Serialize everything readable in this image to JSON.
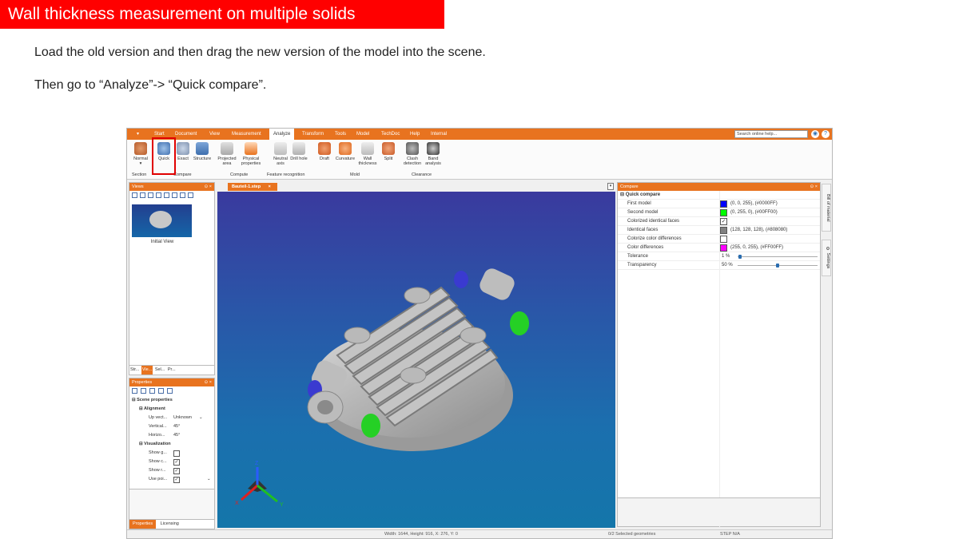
{
  "slide": {
    "title": "Wall thickness measurement on multiple solids",
    "line1": "Load the old version and then drag the new version of the model into the scene.",
    "line2": "Then go to “Analyze”-> “Quick compare”."
  },
  "menubar": {
    "dropdown": "▾",
    "tabs": [
      "Start",
      "Document",
      "View",
      "Measurement",
      "Analyze",
      "Transform",
      "Tools",
      "Model",
      "TechDoc",
      "Help",
      "Internal"
    ],
    "active_tab": "Analyze",
    "search_placeholder": "Search online help...",
    "help_icon": "?"
  },
  "ribbon": {
    "buttons": [
      {
        "label": "Normal",
        "icon": "section-icon"
      },
      {
        "label": "Quick",
        "icon": "quick-compare-icon"
      },
      {
        "label": "Exact",
        "icon": "exact-compare-icon"
      },
      {
        "label": "Structure",
        "icon": "structure-compare-icon"
      },
      {
        "label": "Projected area",
        "icon": "projected-area-icon"
      },
      {
        "label": "Physical properties",
        "icon": "physical-properties-icon"
      },
      {
        "label": "Neutral axis",
        "icon": "neutral-axis-icon"
      },
      {
        "label": "Drill hole",
        "icon": "drill-hole-icon"
      },
      {
        "label": "Draft",
        "icon": "draft-icon"
      },
      {
        "label": "Curvature",
        "icon": "curvature-icon"
      },
      {
        "label": "Wall thickness",
        "icon": "wall-thickness-icon"
      },
      {
        "label": "Split",
        "icon": "split-icon"
      },
      {
        "label": "Clash detection",
        "icon": "clash-detection-icon"
      },
      {
        "label": "Band analysis",
        "icon": "band-analysis-icon"
      }
    ],
    "groups": [
      "Section",
      "Compare",
      "Compute",
      "Feature recognition",
      "Mold",
      "Clearance"
    ]
  },
  "views_panel": {
    "title": "Views",
    "pin": "⊙ ×",
    "thumbnail_label": "Initial View",
    "tabs": [
      "Str...",
      "Vie...",
      "Sel...",
      "Pr..."
    ]
  },
  "properties_panel": {
    "title": "Properties",
    "pin": "⊙ ×",
    "section": "Scene properties",
    "groups": [
      {
        "name": "Alignment",
        "rows": [
          {
            "key": "Up vect...",
            "value": "Unknown"
          },
          {
            "key": "Vertical...",
            "value": "45°"
          },
          {
            "key": "Horizo...",
            "value": "45°"
          }
        ]
      },
      {
        "name": "Visualization",
        "rows": [
          {
            "key": "Show g...",
            "checked": false
          },
          {
            "key": "Show c...",
            "checked": true
          },
          {
            "key": "Show r...",
            "checked": true
          },
          {
            "key": "Use poi...",
            "checked": true
          }
        ]
      }
    ],
    "tabs": [
      "Properties",
      "Licensing"
    ]
  },
  "document": {
    "tab_label": "Bauteil-1.step",
    "close": "×",
    "viewport_dropdown": "▾",
    "axes": {
      "x": "X",
      "y": "Y",
      "z": "Z"
    }
  },
  "compare_panel": {
    "title": "Compare",
    "pin": "⊙ ×",
    "section": "Quick compare",
    "rows": [
      {
        "key": "First model",
        "color": "#0000ff",
        "value": "(0, 0, 255), (#0000FF)"
      },
      {
        "key": "Second model",
        "color": "#00ff00",
        "value": "(0, 255, 0), (#00FF00)"
      },
      {
        "key": "Colorized identical faces",
        "checkbox": true
      },
      {
        "key": "Identical faces",
        "color": "#808080",
        "value": "(128, 128, 128), (#808080)"
      },
      {
        "key": "Colorize color differences",
        "checkbox": false
      },
      {
        "key": "Color differences",
        "color": "#ff00ff",
        "value": "(255, 0, 255), (#FF00FF)"
      },
      {
        "key": "Tolerance",
        "value": "1 %",
        "slider": 0.01
      },
      {
        "key": "Transparency",
        "value": "50 %",
        "slider": 0.5
      }
    ]
  },
  "side_tabs": [
    "Bill of material",
    "Settings"
  ],
  "statusbar": {
    "dimensions": "Width: 1644, Height: 916, X: 276, Y: 0",
    "selection": "0/2 Selected geometries",
    "format": "STEP N/A"
  }
}
